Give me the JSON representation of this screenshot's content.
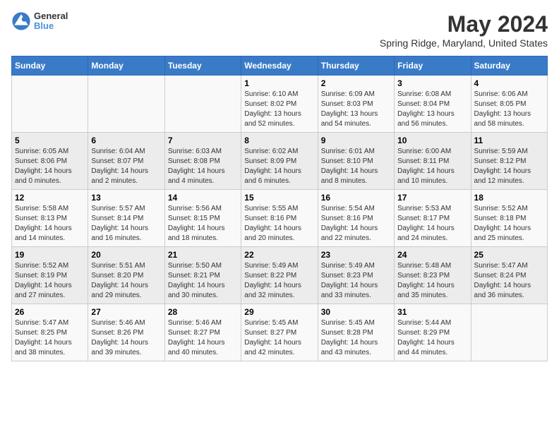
{
  "header": {
    "logo_line1": "General",
    "logo_line2": "Blue",
    "title": "May 2024",
    "subtitle": "Spring Ridge, Maryland, United States"
  },
  "days_of_week": [
    "Sunday",
    "Monday",
    "Tuesday",
    "Wednesday",
    "Thursday",
    "Friday",
    "Saturday"
  ],
  "weeks": [
    [
      {
        "day": "",
        "info": ""
      },
      {
        "day": "",
        "info": ""
      },
      {
        "day": "",
        "info": ""
      },
      {
        "day": "1",
        "info": "Sunrise: 6:10 AM\nSunset: 8:02 PM\nDaylight: 13 hours\nand 52 minutes."
      },
      {
        "day": "2",
        "info": "Sunrise: 6:09 AM\nSunset: 8:03 PM\nDaylight: 13 hours\nand 54 minutes."
      },
      {
        "day": "3",
        "info": "Sunrise: 6:08 AM\nSunset: 8:04 PM\nDaylight: 13 hours\nand 56 minutes."
      },
      {
        "day": "4",
        "info": "Sunrise: 6:06 AM\nSunset: 8:05 PM\nDaylight: 13 hours\nand 58 minutes."
      }
    ],
    [
      {
        "day": "5",
        "info": "Sunrise: 6:05 AM\nSunset: 8:06 PM\nDaylight: 14 hours\nand 0 minutes."
      },
      {
        "day": "6",
        "info": "Sunrise: 6:04 AM\nSunset: 8:07 PM\nDaylight: 14 hours\nand 2 minutes."
      },
      {
        "day": "7",
        "info": "Sunrise: 6:03 AM\nSunset: 8:08 PM\nDaylight: 14 hours\nand 4 minutes."
      },
      {
        "day": "8",
        "info": "Sunrise: 6:02 AM\nSunset: 8:09 PM\nDaylight: 14 hours\nand 6 minutes."
      },
      {
        "day": "9",
        "info": "Sunrise: 6:01 AM\nSunset: 8:10 PM\nDaylight: 14 hours\nand 8 minutes."
      },
      {
        "day": "10",
        "info": "Sunrise: 6:00 AM\nSunset: 8:11 PM\nDaylight: 14 hours\nand 10 minutes."
      },
      {
        "day": "11",
        "info": "Sunrise: 5:59 AM\nSunset: 8:12 PM\nDaylight: 14 hours\nand 12 minutes."
      }
    ],
    [
      {
        "day": "12",
        "info": "Sunrise: 5:58 AM\nSunset: 8:13 PM\nDaylight: 14 hours\nand 14 minutes."
      },
      {
        "day": "13",
        "info": "Sunrise: 5:57 AM\nSunset: 8:14 PM\nDaylight: 14 hours\nand 16 minutes."
      },
      {
        "day": "14",
        "info": "Sunrise: 5:56 AM\nSunset: 8:15 PM\nDaylight: 14 hours\nand 18 minutes."
      },
      {
        "day": "15",
        "info": "Sunrise: 5:55 AM\nSunset: 8:16 PM\nDaylight: 14 hours\nand 20 minutes."
      },
      {
        "day": "16",
        "info": "Sunrise: 5:54 AM\nSunset: 8:16 PM\nDaylight: 14 hours\nand 22 minutes."
      },
      {
        "day": "17",
        "info": "Sunrise: 5:53 AM\nSunset: 8:17 PM\nDaylight: 14 hours\nand 24 minutes."
      },
      {
        "day": "18",
        "info": "Sunrise: 5:52 AM\nSunset: 8:18 PM\nDaylight: 14 hours\nand 25 minutes."
      }
    ],
    [
      {
        "day": "19",
        "info": "Sunrise: 5:52 AM\nSunset: 8:19 PM\nDaylight: 14 hours\nand 27 minutes."
      },
      {
        "day": "20",
        "info": "Sunrise: 5:51 AM\nSunset: 8:20 PM\nDaylight: 14 hours\nand 29 minutes."
      },
      {
        "day": "21",
        "info": "Sunrise: 5:50 AM\nSunset: 8:21 PM\nDaylight: 14 hours\nand 30 minutes."
      },
      {
        "day": "22",
        "info": "Sunrise: 5:49 AM\nSunset: 8:22 PM\nDaylight: 14 hours\nand 32 minutes."
      },
      {
        "day": "23",
        "info": "Sunrise: 5:49 AM\nSunset: 8:23 PM\nDaylight: 14 hours\nand 33 minutes."
      },
      {
        "day": "24",
        "info": "Sunrise: 5:48 AM\nSunset: 8:23 PM\nDaylight: 14 hours\nand 35 minutes."
      },
      {
        "day": "25",
        "info": "Sunrise: 5:47 AM\nSunset: 8:24 PM\nDaylight: 14 hours\nand 36 minutes."
      }
    ],
    [
      {
        "day": "26",
        "info": "Sunrise: 5:47 AM\nSunset: 8:25 PM\nDaylight: 14 hours\nand 38 minutes."
      },
      {
        "day": "27",
        "info": "Sunrise: 5:46 AM\nSunset: 8:26 PM\nDaylight: 14 hours\nand 39 minutes."
      },
      {
        "day": "28",
        "info": "Sunrise: 5:46 AM\nSunset: 8:27 PM\nDaylight: 14 hours\nand 40 minutes."
      },
      {
        "day": "29",
        "info": "Sunrise: 5:45 AM\nSunset: 8:27 PM\nDaylight: 14 hours\nand 42 minutes."
      },
      {
        "day": "30",
        "info": "Sunrise: 5:45 AM\nSunset: 8:28 PM\nDaylight: 14 hours\nand 43 minutes."
      },
      {
        "day": "31",
        "info": "Sunrise: 5:44 AM\nSunset: 8:29 PM\nDaylight: 14 hours\nand 44 minutes."
      },
      {
        "day": "",
        "info": ""
      }
    ]
  ]
}
